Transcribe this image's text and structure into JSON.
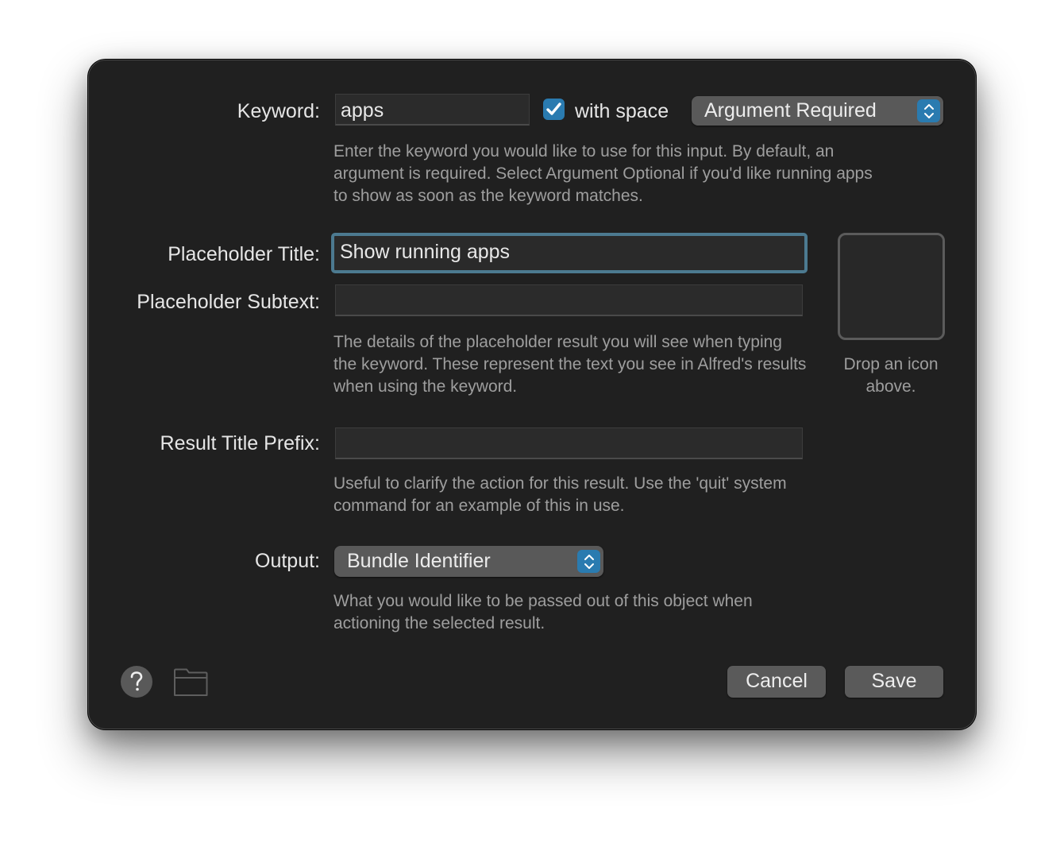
{
  "keyword": {
    "label": "Keyword:",
    "value": "apps",
    "with_space_label": "with space",
    "with_space_checked": true,
    "argument_mode": "Argument Required",
    "help": "Enter the keyword you would like to use for this input. By default, an argument is required. Select Argument Optional if you'd like running apps to show as soon as the keyword matches."
  },
  "placeholder_title": {
    "label": "Placeholder Title:",
    "value": "Show running apps"
  },
  "placeholder_subtext": {
    "label": "Placeholder Subtext:",
    "value": "",
    "help": "The details of the placeholder result you will see when typing the keyword. These represent the text you see in Alfred's results when using the keyword."
  },
  "icon_well": {
    "caption": "Drop an icon above."
  },
  "result_title_prefix": {
    "label": "Result Title Prefix:",
    "value": "",
    "help": "Useful to clarify the action for this result. Use the 'quit' system command for an example of this in use."
  },
  "output": {
    "label": "Output:",
    "selected": "Bundle Identifier",
    "help": "What you would like to be passed out of this object when actioning the selected result."
  },
  "footer": {
    "help_icon": "question-mark",
    "folder_icon": "folder",
    "cancel_label": "Cancel",
    "save_label": "Save"
  },
  "colors": {
    "accent": "#2a7bb0",
    "focus_ring": "#4c7a90",
    "background": "#202020"
  }
}
